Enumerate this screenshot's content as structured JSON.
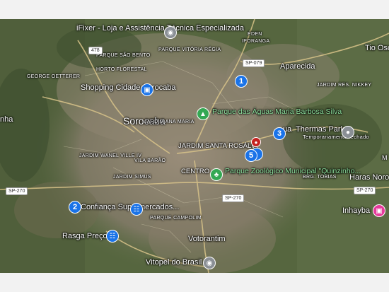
{
  "map": {
    "places": {
      "ifixer": "iFixer - Loja e Assistência Técnica Especializada",
      "sorocaba": "Sorocaba",
      "shopping": "Shopping Cidade Sorocaba",
      "parque_aguas": "Parque das Águas Maria Barbosa Silva",
      "thermas": "Thermas Park",
      "thermas_status": "Temporariamente fechado",
      "aparecida": "Aparecida",
      "tio_oscar": "Tio Osc",
      "confianca": "Confiança Supermercados...",
      "rasga": "Rasga Preço",
      "zoologico": "Parque Zoológico Municipal \"Quinzinho...",
      "votorantim": "Votorantim",
      "vitopel": "Vitopel do Brasil",
      "inhayba": "Inhayba",
      "haras": "Haras Noron",
      "anha": "nha",
      "thermas_prefix": "ua"
    },
    "neighborhoods": {
      "eden": "ÉDEN",
      "ipanga": "IPORANGA",
      "parque_sao_bento": "PARQUE SÃO BENTO",
      "horto": "HORTO FLORESTAL",
      "parque_vitoria": "PARQUE VITÓRIA RÉGIA",
      "george": "GEORGE OETTERER",
      "jardim_ana_maria": "JARDIM ANA MARIA",
      "jardim_santa_rosalia": "JARDIM SANTA ROSÁLIA",
      "jardim_wanel": "JARDIM WANEL VILLE IV",
      "vila_barao": "VILA BARÃO",
      "centro": "CENTRO",
      "jardim_simus": "JARDIM SIMUS",
      "parque_campolim": "PARQUE CAMPOLIM",
      "jardim_res_nikkey": "JARDIM RES. NIKKEY",
      "brg_tobias": "BRG. TOBIAS",
      "m": "M"
    },
    "roads": {
      "r478": "478",
      "sp079": "SP-079",
      "sp270_w": "SP-270",
      "sp270_c": "SP-270",
      "sp270_e": "SP-270"
    },
    "markers": [
      "1",
      "2",
      "3",
      "5"
    ]
  }
}
